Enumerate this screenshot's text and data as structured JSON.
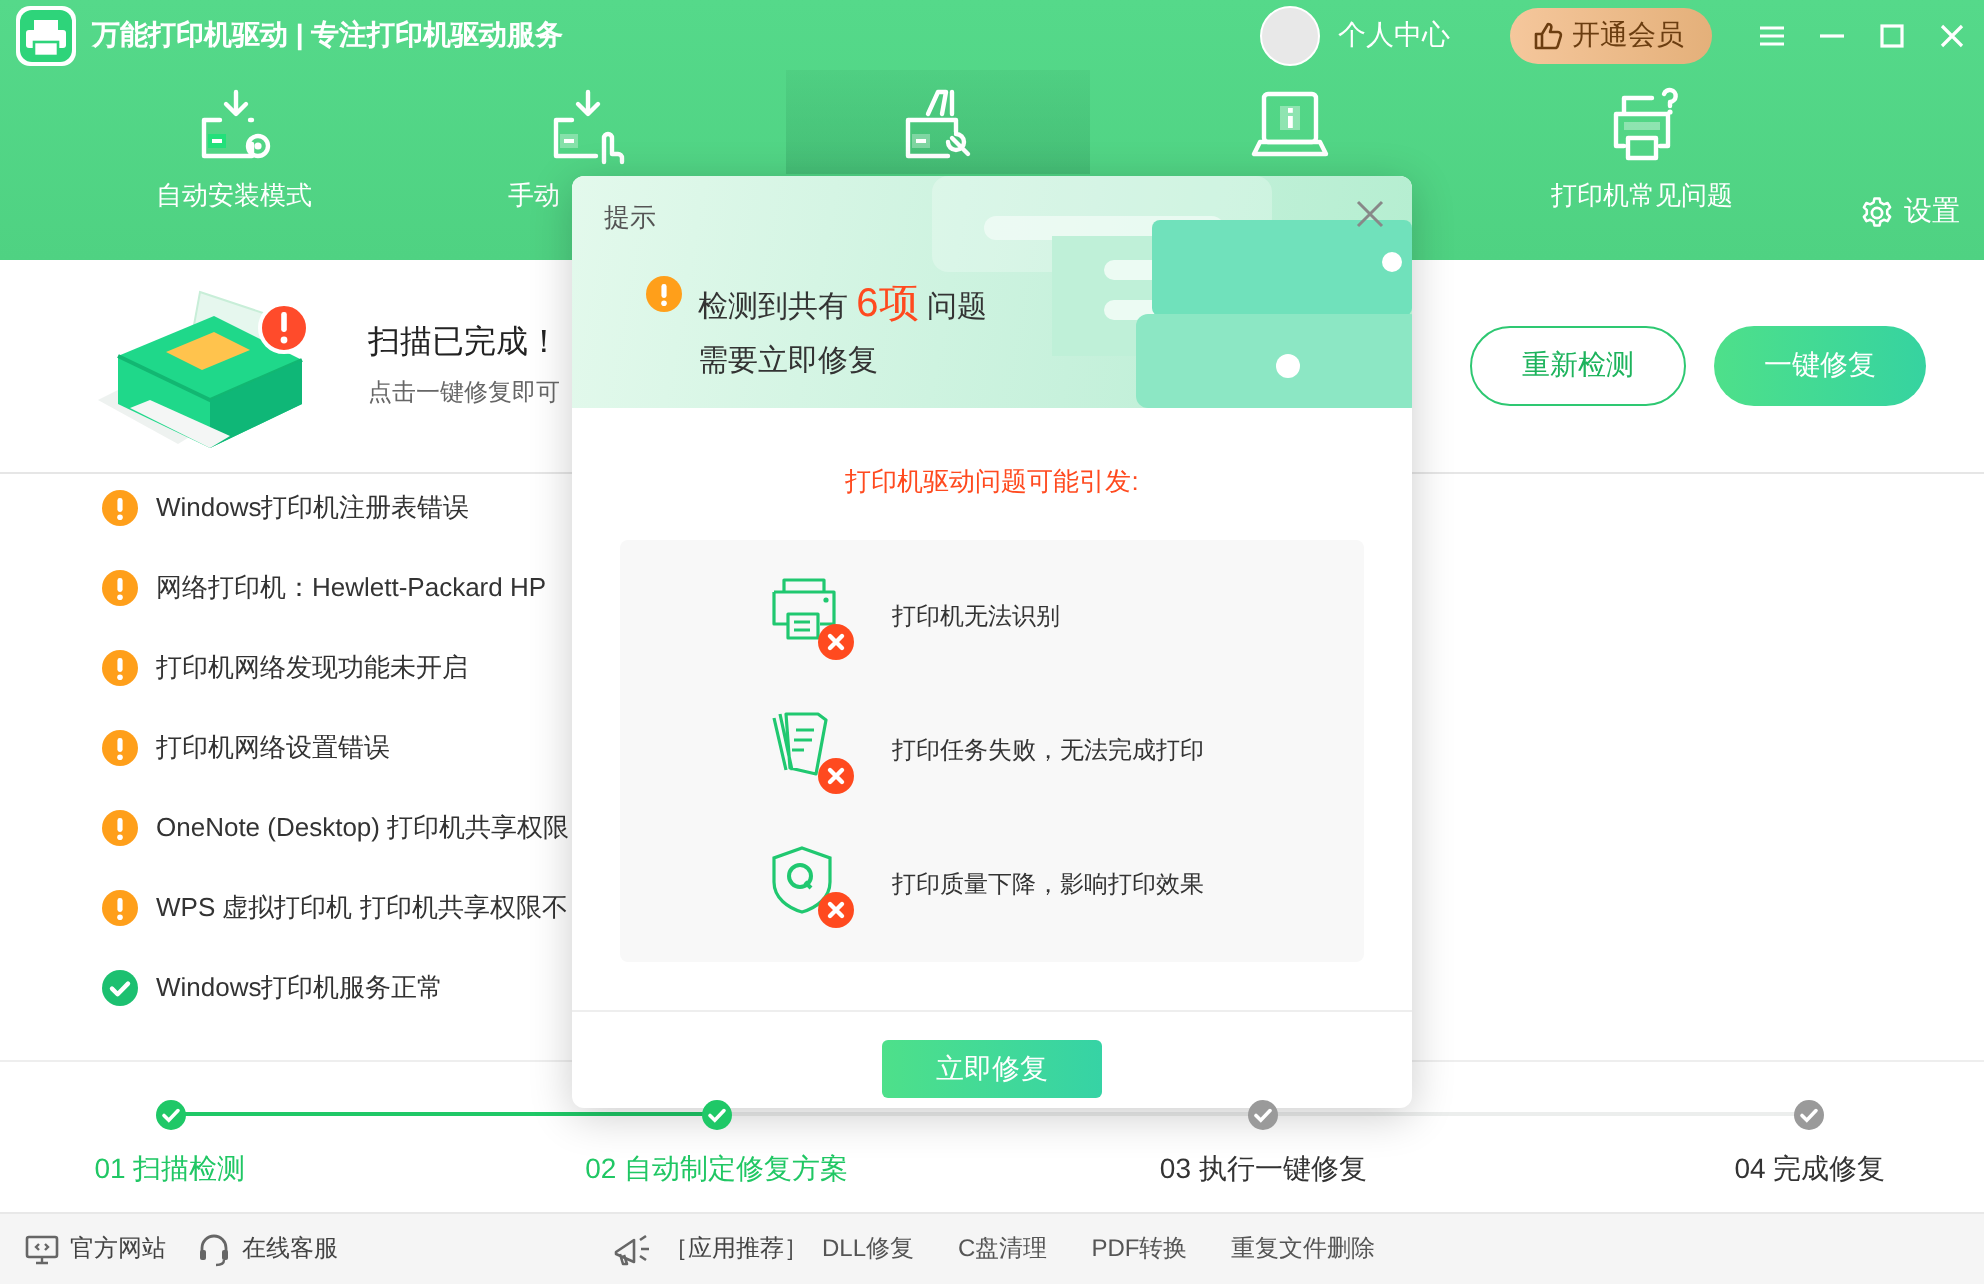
{
  "window": {
    "title": "万能打印机驱动 | 专注打印机驱动服务",
    "user_label": "个人中心",
    "vip_button": "开通会员"
  },
  "nav": {
    "tabs": [
      {
        "label": "自动安装模式",
        "selected": false
      },
      {
        "label": "手动",
        "selected": false
      },
      {
        "selected": true
      },
      {
        "selected": false
      },
      {
        "label": "打印机常见问题",
        "selected": false
      }
    ],
    "settings": "设置"
  },
  "scan_result": {
    "title": "扫描已完成！",
    "subtitle": "点击一键修复即可",
    "rescan_button": "重新检测",
    "fix_button": "一键修复"
  },
  "issues": [
    {
      "text": "Windows打印机注册表错误",
      "resolved": false
    },
    {
      "text": "网络打印机：Hewlett-Packard HP",
      "resolved": false
    },
    {
      "text": "打印机网络发现功能未开启",
      "resolved": false
    },
    {
      "text": "打印机网络设置错误",
      "resolved": false
    },
    {
      "text": "OneNote (Desktop) 打印机共享权限",
      "resolved": false
    },
    {
      "text": "WPS 虚拟打印机 打印机共享权限不",
      "resolved": false
    },
    {
      "text": "Windows打印机服务正常",
      "resolved": true
    }
  ],
  "steps": [
    {
      "label": "01 扫描检测",
      "done": true
    },
    {
      "label": "02 自动制定修复方案",
      "done": true
    },
    {
      "label": "03 执行一键修复",
      "done": false
    },
    {
      "label": "04 完成修复",
      "done": false
    }
  ],
  "footer": {
    "links": [
      "官方网站",
      "在线客服"
    ],
    "promo_label": "［应用推荐］",
    "apps": [
      "DLL修复",
      "C盘清理",
      "PDF转换",
      "重复文件删除"
    ]
  },
  "dialog": {
    "title": "提示",
    "message": "检测到共有 **6项** 问题",
    "message_line2": "需要立即修复",
    "heading": "打印机驱动问题可能引发:",
    "effects": [
      "打印机无法识别",
      "打印任务失败，无法完成打印",
      "打印质量下降，影响打印效果"
    ],
    "button": "立即修复"
  }
}
